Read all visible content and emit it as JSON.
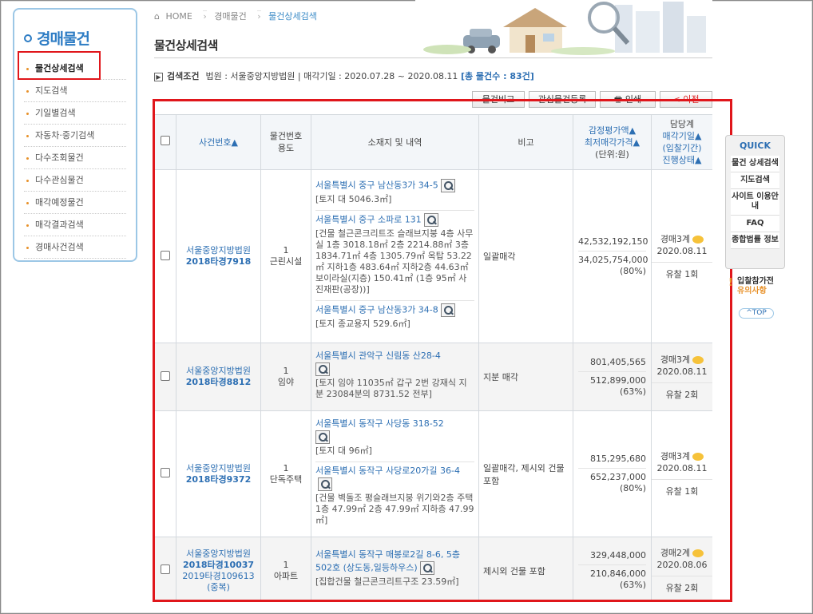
{
  "sidebar": {
    "title": "경매물건",
    "items": [
      {
        "label": "물건상세검색"
      },
      {
        "label": "지도검색"
      },
      {
        "label": "기일별검색"
      },
      {
        "label": "자동차·중기검색"
      },
      {
        "label": "다수조회물건"
      },
      {
        "label": "다수관심물건"
      },
      {
        "label": "매각예정물건"
      },
      {
        "label": "매각결과검색"
      },
      {
        "label": "경매사건검색"
      }
    ]
  },
  "breadcrumb": {
    "home": "HOME",
    "level1": "경매물건",
    "current": "물건상세검색"
  },
  "page_title": "물건상세검색",
  "conditions": {
    "label": "검색조건",
    "text": "법원 : 서울중앙지방법원 | 매각기일 : 2020.07.28 ~ 2020.08.11",
    "count": "[총 물건수 : 83건]"
  },
  "toolbar": {
    "compare": "물건비교",
    "interest": "관심물건등록",
    "print": "인쇄",
    "prev": "< 이전"
  },
  "table": {
    "headers": {
      "case": "사건번호▲",
      "use": [
        "물건번호",
        "용도"
      ],
      "location": "소재지 및 내역",
      "note": "비고",
      "price": [
        "감정평가액▲",
        "최저매각가격▲",
        "(단위:원)"
      ],
      "status": [
        "담당계",
        "매각기일▲",
        "(입찰기간)",
        "진행상태▲"
      ]
    },
    "rows": [
      {
        "court": "서울중앙지방법원",
        "case_no": "2018타경7918",
        "item_no": "1",
        "use": "근린시설",
        "locations": [
          {
            "addr": "서울특별시 중구 남산동3가 34-5",
            "desc": "[토지 대 5046.3㎡]"
          },
          {
            "addr": "서울특별시 중구 소파로 131",
            "desc": "[건물 철근콘크리트조 슬래브지붕 4층 사무실 1층 3018.18㎡ 2층 2214.88㎡ 3층 1834.71㎡ 4층 1305.79㎡ 옥탑 53.22㎡ 지하1층 483.64㎡ 지하2층 44.63㎡ 보이라실(지층) 150.41㎡ (1층 95㎡ 사진재판(공장))]"
          },
          {
            "addr": "서울특별시 중구 남산동3가 34-8",
            "desc": "[토지 종교용지 529.6㎡]"
          }
        ],
        "note": "일괄매각",
        "appraisal": "42,532,192,150",
        "minimum": "34,025,754,000",
        "ratio": "(80%)",
        "dept": "경매3계",
        "date": "2020.08.11",
        "status": "유찰 1회"
      },
      {
        "court": "서울중앙지방법원",
        "case_no": "2018타경8812",
        "item_no": "1",
        "use": "임야",
        "locations": [
          {
            "addr": "서울특별시 관악구 신림동 산28-4",
            "desc": "[토지 임야 11035㎡ 갑구 2번 강재식 지분 23084분의 8731.52 전부]"
          }
        ],
        "note": "지분 매각",
        "appraisal": "801,405,565",
        "minimum": "512,899,000",
        "ratio": "(63%)",
        "dept": "경매3계",
        "date": "2020.08.11",
        "status": "유찰 2회"
      },
      {
        "court": "서울중앙지방법원",
        "case_no": "2018타경9372",
        "item_no": "1",
        "use": "단독주택",
        "locations": [
          {
            "addr": "서울특별시 동작구 사당동 318-52",
            "desc": "[토지 대 96㎡]"
          },
          {
            "addr": "서울특별시 동작구 사당로20가길 36-4",
            "desc": "[건물 벽돌조 평슬래브지붕 위기와2층 주택 1층 47.99㎡ 2층 47.99㎡ 지하층 47.99㎡]"
          }
        ],
        "note": "일괄매각, 제시외 건물 포함",
        "appraisal": "815,295,680",
        "minimum": "652,237,000",
        "ratio": "(80%)",
        "dept": "경매3계",
        "date": "2020.08.11",
        "status": "유찰 1회"
      },
      {
        "court": "서울중앙지방법원",
        "case_no": "2018타경10037",
        "extra_case": "2019타경109613",
        "extra_note": "(중복)",
        "item_no": "1",
        "use": "아파트",
        "locations": [
          {
            "addr": "서울특별시 동작구 매봉로2길 8-6, 5층502호 (상도동,일등하우스)",
            "desc": "[집합건물 철근콘크리트구조 23.59㎡]"
          }
        ],
        "note": "제시외 건물 포함",
        "appraisal": "329,448,000",
        "minimum": "210,846,000",
        "ratio": "(63%)",
        "dept": "경매2계",
        "date": "2020.08.06",
        "status": "유찰 2회"
      }
    ]
  },
  "quick": {
    "title": "QUICK",
    "items": [
      "물건 상세검색",
      "지도검색",
      "사이트 이용안내",
      "FAQ",
      "종합법률 정보"
    ]
  },
  "notice": {
    "line1": "입찰참가전",
    "line2": "유의사항"
  },
  "top_button": "^TOP"
}
